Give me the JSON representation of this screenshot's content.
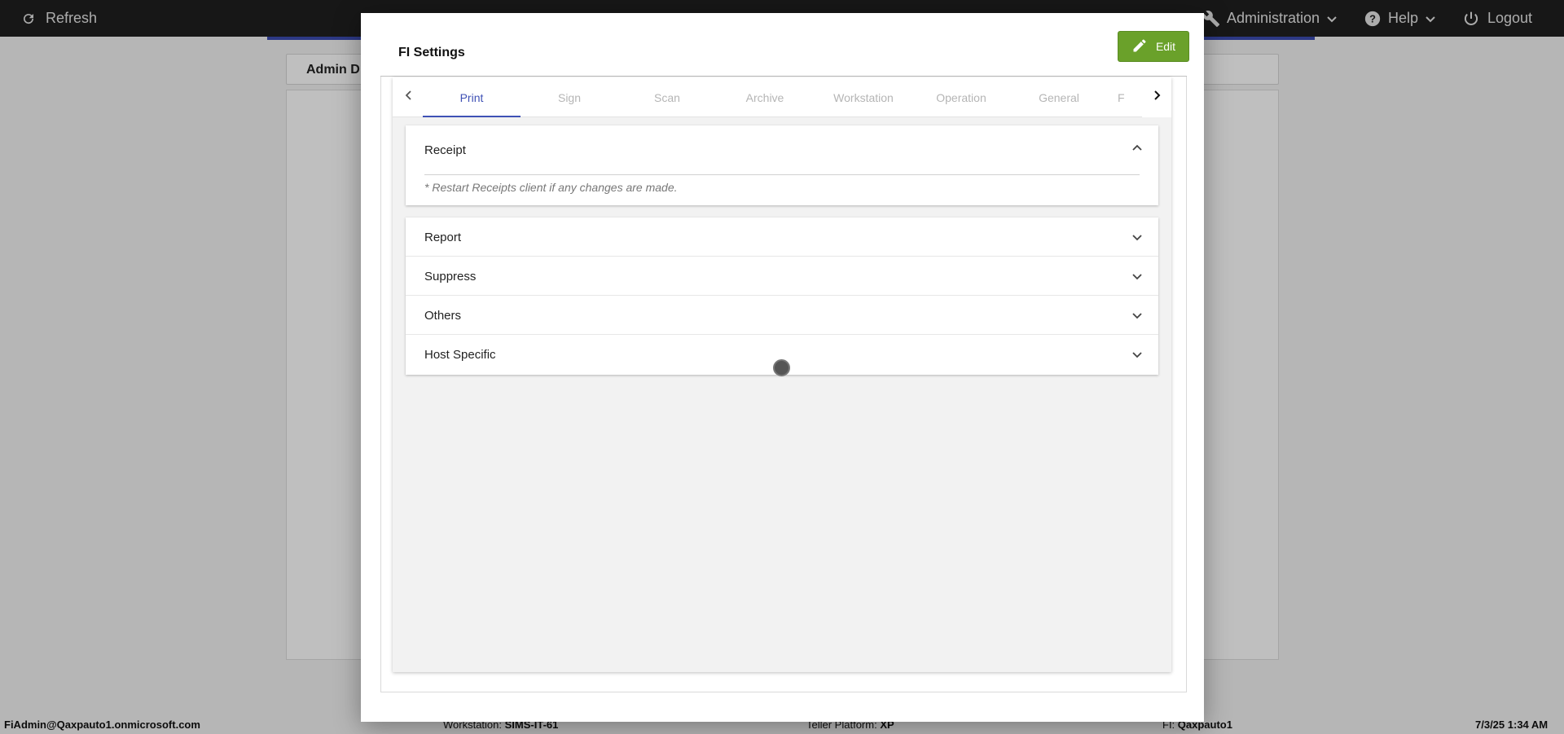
{
  "topbar": {
    "refresh_label": "Refresh",
    "administration_label": "Administration",
    "help_label": "Help",
    "logout_label": "Logout"
  },
  "background": {
    "header_title": "Admin D"
  },
  "footer": {
    "user": "FiAdmin@Qaxpauto1.onmicrosoft.com",
    "workstation_label": "Workstation:",
    "workstation_value": "SIMS-IT-61",
    "platform_label": "Teller Platform:",
    "platform_value": "XP",
    "fi_label": "FI:",
    "fi_value": "Qaxpauto1",
    "datetime": "7/3/25 1:34 AM"
  },
  "modal": {
    "title": "FI Settings",
    "edit_label": "Edit",
    "tabs": [
      {
        "label": "Print",
        "active": true
      },
      {
        "label": "Sign",
        "active": false
      },
      {
        "label": "Scan",
        "active": false
      },
      {
        "label": "Archive",
        "active": false
      },
      {
        "label": "Workstation",
        "active": false
      },
      {
        "label": "Operation",
        "active": false
      },
      {
        "label": "General",
        "active": false
      },
      {
        "label": "F",
        "active": false
      }
    ],
    "receipt": {
      "label": "Receipt",
      "expanded": true,
      "note": "* Restart Receipts client if any changes are made."
    },
    "sections": [
      {
        "label": "Report",
        "expanded": false
      },
      {
        "label": "Suppress",
        "expanded": false
      },
      {
        "label": "Others",
        "expanded": false
      },
      {
        "label": "Host Specific",
        "expanded": false
      }
    ]
  },
  "colors": {
    "topbar_bg": "#1f1f1f",
    "accent": "#3f51b5",
    "edit_button": "#6aa12a",
    "inactive_tab": "#b5b5b5"
  },
  "icons": {
    "refresh": "refresh-icon",
    "administration": "wrench-icon",
    "help": "help-circle-icon",
    "logout": "power-icon",
    "edit": "pencil-icon",
    "tab_prev": "chevron-left-icon",
    "tab_next": "chevron-right-icon",
    "collapse": "chevron-up-icon",
    "expand": "chevron-down-icon"
  }
}
